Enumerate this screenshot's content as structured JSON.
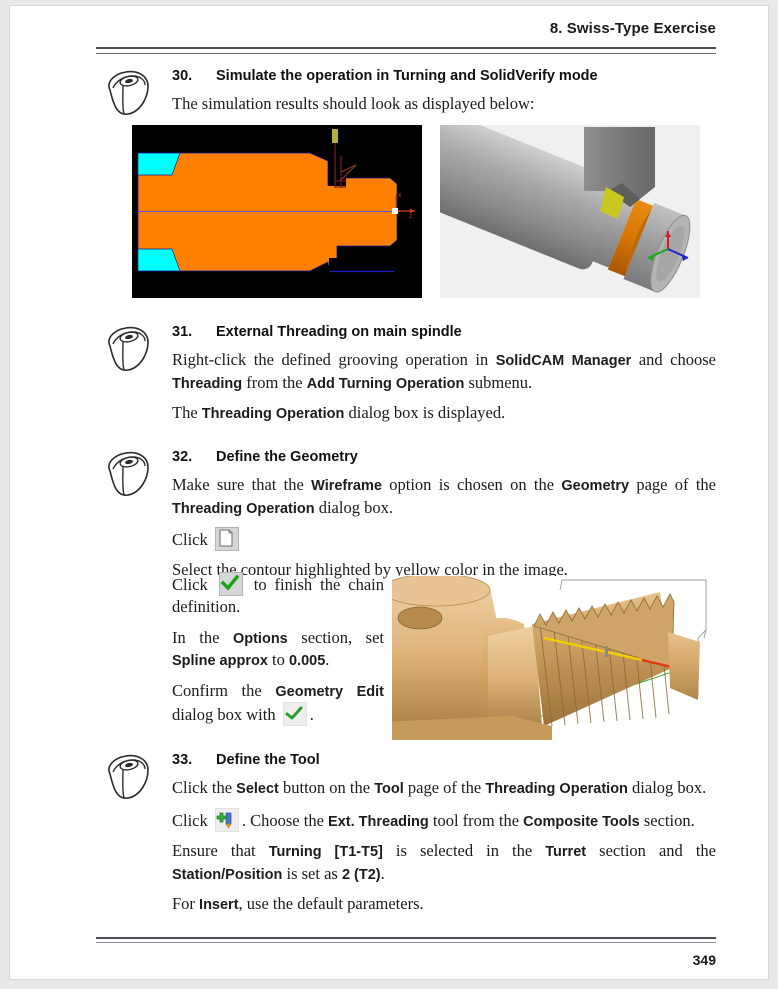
{
  "document": {
    "header_title": "8. Swiss-Type Exercise",
    "page_number": "349"
  },
  "steps": [
    {
      "number": "30.",
      "title": "Simulate the operation in Turning and SolidVerify mode",
      "intro": "The simulation results should look as displayed below:",
      "figures": [
        {
          "name": "turning-simulation",
          "caption": ""
        },
        {
          "name": "solidverify-simulation",
          "caption": ""
        }
      ]
    },
    {
      "number": "31.",
      "title": "External Threading on main spindle",
      "paragraph_1_parts": [
        {
          "text": "Right-click the defined grooving operation in ",
          "bold": false
        },
        {
          "text": "SolidCAM Manager",
          "bold": true
        },
        {
          "text": " and choose ",
          "bold": false
        },
        {
          "text": "Threading",
          "bold": true
        },
        {
          "text": " from the ",
          "bold": false
        },
        {
          "text": "Add Turning Operation",
          "bold": true
        },
        {
          "text": " submenu.",
          "bold": false
        }
      ],
      "paragraph_2_parts": [
        {
          "text": "The ",
          "bold": false
        },
        {
          "text": "Threading Operation",
          "bold": true
        },
        {
          "text": " dialog box is displayed.",
          "bold": false
        }
      ]
    },
    {
      "number": "32.",
      "title": "Define the Geometry",
      "paragraph_1_parts": [
        {
          "text": "Make sure that the ",
          "bold": false
        },
        {
          "text": "Wireframe",
          "bold": true
        },
        {
          "text": " option is chosen on the ",
          "bold": false
        },
        {
          "text": "Geometry",
          "bold": true
        },
        {
          "text": " page of the ",
          "bold": false
        },
        {
          "text": "Threading Operation",
          "bold": true
        },
        {
          "text": " dialog box.",
          "bold": false
        }
      ],
      "click_label_1": "Click",
      "icon_1": "page-document-icon",
      "paragraph_2": "Select the contour highlighted by yellow color in the image.",
      "click_label_2": "Click",
      "icon_2": "green-check-icon",
      "paragraph_3_suffix": " to finish the chain definition.",
      "paragraph_4_parts": [
        {
          "text": "In the ",
          "bold": false
        },
        {
          "text": "Options",
          "bold": true
        },
        {
          "text": " section, set ",
          "bold": false
        },
        {
          "text": "Spline approx",
          "bold": true
        },
        {
          "text": " to ",
          "bold": false
        },
        {
          "text": "0.005",
          "bold": true
        },
        {
          "text": ".",
          "bold": false
        }
      ],
      "paragraph_5_parts": [
        {
          "text": "Confirm the ",
          "bold": false
        },
        {
          "text": "Geometry Edit",
          "bold": true
        },
        {
          "text": " dialog box with ",
          "bold": false
        }
      ],
      "icon_3": "green-check-icon",
      "paragraph_5_end": ".",
      "figure": {
        "name": "threading-geometry-model"
      }
    },
    {
      "number": "33.",
      "title": "Define the Tool",
      "paragraph_1_parts": [
        {
          "text": "Click the ",
          "bold": false
        },
        {
          "text": "Select",
          "bold": true
        },
        {
          "text": " button on the ",
          "bold": false
        },
        {
          "text": "Tool",
          "bold": true
        },
        {
          "text": " page of the ",
          "bold": false
        },
        {
          "text": "Threading Operation",
          "bold": true
        },
        {
          "text": " dialog box.",
          "bold": false
        }
      ],
      "click_label": "Click",
      "icon": "add-tool-icon",
      "paragraph_2_parts": [
        {
          "text": ". Choose the ",
          "bold": false
        },
        {
          "text": "Ext. Threading",
          "bold": true
        },
        {
          "text": " tool from the ",
          "bold": false
        },
        {
          "text": "Composite Tools",
          "bold": true
        },
        {
          "text": " section.",
          "bold": false
        }
      ],
      "paragraph_3_parts": [
        {
          "text": "Ensure that ",
          "bold": false
        },
        {
          "text": "Turning [T1-T5]",
          "bold": true
        },
        {
          "text": " is selected in the ",
          "bold": false
        },
        {
          "text": "Turret",
          "bold": true
        },
        {
          "text": " section and the ",
          "bold": false
        },
        {
          "text": "Station/Position",
          "bold": true
        },
        {
          "text": " is set as ",
          "bold": false
        },
        {
          "text": "2 (T2)",
          "bold": true
        },
        {
          "text": ".",
          "bold": false
        }
      ],
      "paragraph_4_parts": [
        {
          "text": "For ",
          "bold": false
        },
        {
          "text": "Insert",
          "bold": true
        },
        {
          "text": ", use the default parameters.",
          "bold": false
        }
      ]
    }
  ],
  "colors": {
    "page_background": "#ffffff",
    "outer_background": "#e9e9e9",
    "rule": "#4a4f58",
    "stock_orange": "#ff7f00",
    "stock_cyan": "#00ffff",
    "sim_background": "#000000",
    "verify_background": "#f0f0f0",
    "model_tan": "#d4a86a",
    "check_green": "#2aa02a"
  }
}
